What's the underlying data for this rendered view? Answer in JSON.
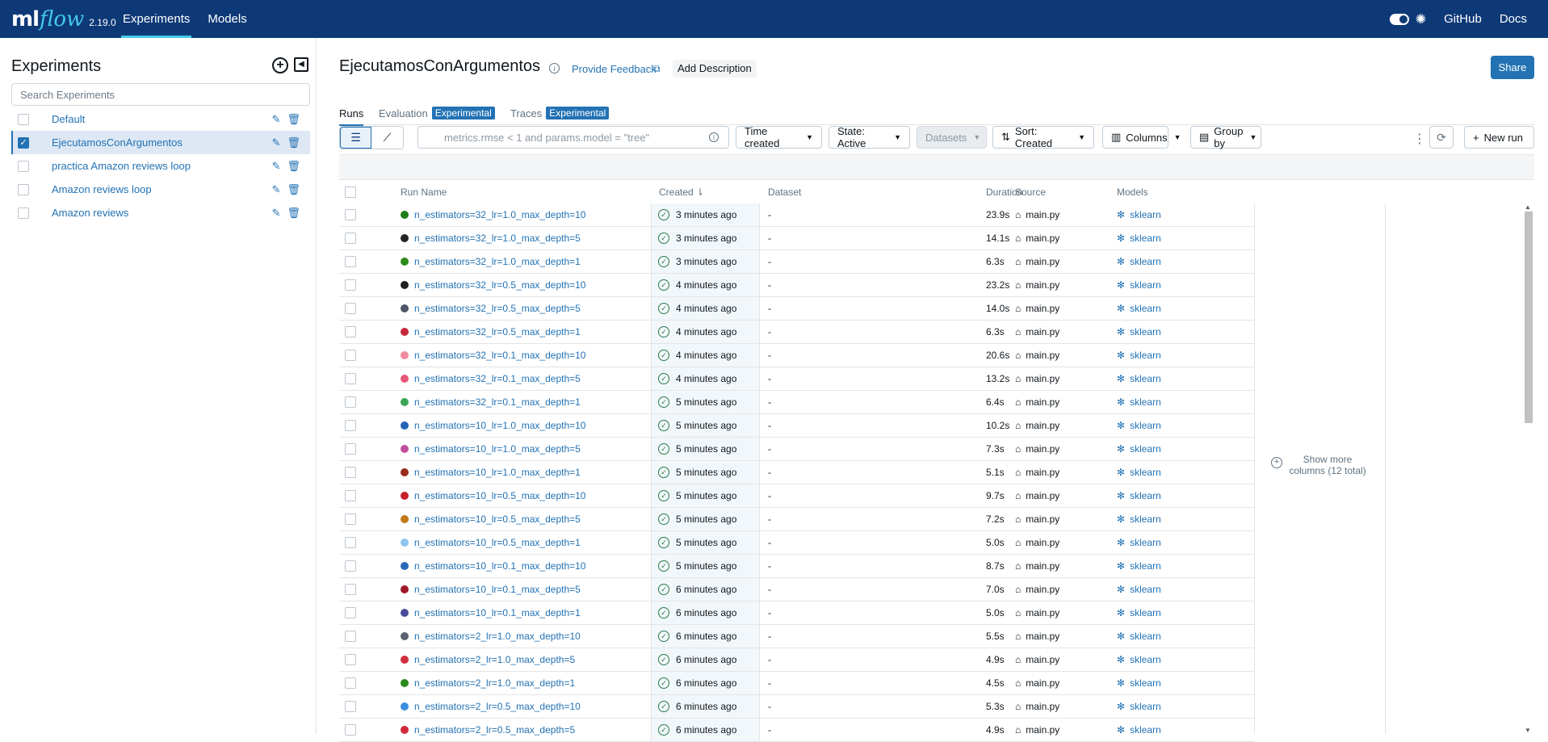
{
  "header": {
    "logo_ml": "ml",
    "logo_flow": "flow",
    "version": "2.19.0",
    "nav": [
      {
        "label": "Experiments"
      },
      {
        "label": "Models"
      }
    ],
    "github": "GitHub",
    "docs": "Docs"
  },
  "sidebar": {
    "title": "Experiments",
    "search_placeholder": "Search Experiments",
    "items": [
      {
        "name": "Default",
        "selected": false
      },
      {
        "name": "EjecutamosConArgumentos",
        "selected": true
      },
      {
        "name": "practica Amazon reviews loop",
        "selected": false
      },
      {
        "name": "Amazon reviews loop",
        "selected": false
      },
      {
        "name": "Amazon reviews",
        "selected": false
      }
    ]
  },
  "main": {
    "title": "EjecutamosConArgumentos",
    "provide_feedback": "Provide Feedback",
    "add_description": "Add Description",
    "share": "Share",
    "tabs": {
      "runs": "Runs",
      "evaluation": "Evaluation",
      "traces": "Traces",
      "experimental": "Experimental"
    },
    "toolbar": {
      "filter_placeholder": "metrics.rmse < 1 and params.model = \"tree\"",
      "time_created": "Time created",
      "state": "State: Active",
      "datasets": "Datasets",
      "sort": "Sort: Created",
      "columns": "Columns",
      "group_by": "Group by",
      "new_run": "New run"
    },
    "columns": {
      "run_name": "Run Name",
      "created": "Created",
      "dataset": "Dataset",
      "duration": "Duration",
      "source": "Source",
      "models": "Models"
    },
    "show_more": "Show more columns (12 total)"
  },
  "runs": [
    {
      "name": "n_estimators=32_lr=1.0_max_depth=10",
      "created": "3 minutes ago",
      "dataset": "-",
      "duration": "23.9s",
      "source": "main.py",
      "model": "sklearn",
      "color": "#1e7d19"
    },
    {
      "name": "n_estimators=32_lr=1.0_max_depth=5",
      "created": "3 minutes ago",
      "dataset": "-",
      "duration": "14.1s",
      "source": "main.py",
      "model": "sklearn",
      "color": "#222426"
    },
    {
      "name": "n_estimators=32_lr=1.0_max_depth=1",
      "created": "3 minutes ago",
      "dataset": "-",
      "duration": "6.3s",
      "source": "main.py",
      "model": "sklearn",
      "color": "#2a8a1a"
    },
    {
      "name": "n_estimators=32_lr=0.5_max_depth=10",
      "created": "4 minutes ago",
      "dataset": "-",
      "duration": "23.2s",
      "source": "main.py",
      "model": "sklearn",
      "color": "#1f2123"
    },
    {
      "name": "n_estimators=32_lr=0.5_max_depth=5",
      "created": "4 minutes ago",
      "dataset": "-",
      "duration": "14.0s",
      "source": "main.py",
      "model": "sklearn",
      "color": "#4b5563"
    },
    {
      "name": "n_estimators=32_lr=0.5_max_depth=1",
      "created": "4 minutes ago",
      "dataset": "-",
      "duration": "6.3s",
      "source": "main.py",
      "model": "sklearn",
      "color": "#c8283c"
    },
    {
      "name": "n_estimators=32_lr=0.1_max_depth=10",
      "created": "4 minutes ago",
      "dataset": "-",
      "duration": "20.6s",
      "source": "main.py",
      "model": "sklearn",
      "color": "#f28aa0"
    },
    {
      "name": "n_estimators=32_lr=0.1_max_depth=5",
      "created": "4 minutes ago",
      "dataset": "-",
      "duration": "13.2s",
      "source": "main.py",
      "model": "sklearn",
      "color": "#e6587a"
    },
    {
      "name": "n_estimators=32_lr=0.1_max_depth=1",
      "created": "5 minutes ago",
      "dataset": "-",
      "duration": "6.4s",
      "source": "main.py",
      "model": "sklearn",
      "color": "#3aa655"
    },
    {
      "name": "n_estimators=10_lr=1.0_max_depth=10",
      "created": "5 minutes ago",
      "dataset": "-",
      "duration": "10.2s",
      "source": "main.py",
      "model": "sklearn",
      "color": "#2264b4"
    },
    {
      "name": "n_estimators=10_lr=1.0_max_depth=5",
      "created": "5 minutes ago",
      "dataset": "-",
      "duration": "7.3s",
      "source": "main.py",
      "model": "sklearn",
      "color": "#c0509a"
    },
    {
      "name": "n_estimators=10_lr=1.0_max_depth=1",
      "created": "5 minutes ago",
      "dataset": "-",
      "duration": "5.1s",
      "source": "main.py",
      "model": "sklearn",
      "color": "#9a2a1a"
    },
    {
      "name": "n_estimators=10_lr=0.5_max_depth=10",
      "created": "5 minutes ago",
      "dataset": "-",
      "duration": "9.7s",
      "source": "main.py",
      "model": "sklearn",
      "color": "#c8202a"
    },
    {
      "name": "n_estimators=10_lr=0.5_max_depth=5",
      "created": "5 minutes ago",
      "dataset": "-",
      "duration": "7.2s",
      "source": "main.py",
      "model": "sklearn",
      "color": "#c07818"
    },
    {
      "name": "n_estimators=10_lr=0.5_max_depth=1",
      "created": "5 minutes ago",
      "dataset": "-",
      "duration": "5.0s",
      "source": "main.py",
      "model": "sklearn",
      "color": "#8ec4ee"
    },
    {
      "name": "n_estimators=10_lr=0.1_max_depth=10",
      "created": "5 minutes ago",
      "dataset": "-",
      "duration": "8.7s",
      "source": "main.py",
      "model": "sklearn",
      "color": "#2a6ab8"
    },
    {
      "name": "n_estimators=10_lr=0.1_max_depth=5",
      "created": "6 minutes ago",
      "dataset": "-",
      "duration": "7.0s",
      "source": "main.py",
      "model": "sklearn",
      "color": "#a0182a"
    },
    {
      "name": "n_estimators=10_lr=0.1_max_depth=1",
      "created": "6 minutes ago",
      "dataset": "-",
      "duration": "5.0s",
      "source": "main.py",
      "model": "sklearn",
      "color": "#4a4a9a"
    },
    {
      "name": "n_estimators=2_lr=1.0_max_depth=10",
      "created": "6 minutes ago",
      "dataset": "-",
      "duration": "5.5s",
      "source": "main.py",
      "model": "sklearn",
      "color": "#5a6470"
    },
    {
      "name": "n_estimators=2_lr=1.0_max_depth=5",
      "created": "6 minutes ago",
      "dataset": "-",
      "duration": "4.9s",
      "source": "main.py",
      "model": "sklearn",
      "color": "#d0303c"
    },
    {
      "name": "n_estimators=2_lr=1.0_max_depth=1",
      "created": "6 minutes ago",
      "dataset": "-",
      "duration": "4.5s",
      "source": "main.py",
      "model": "sklearn",
      "color": "#2a8a1a"
    },
    {
      "name": "n_estimators=2_lr=0.5_max_depth=10",
      "created": "6 minutes ago",
      "dataset": "-",
      "duration": "5.3s",
      "source": "main.py",
      "model": "sklearn",
      "color": "#3a8ee0"
    },
    {
      "name": "n_estimators=2_lr=0.5_max_depth=5",
      "created": "6 minutes ago",
      "dataset": "-",
      "duration": "4.9s",
      "source": "main.py",
      "model": "sklearn",
      "color": "#d02a3a"
    }
  ]
}
